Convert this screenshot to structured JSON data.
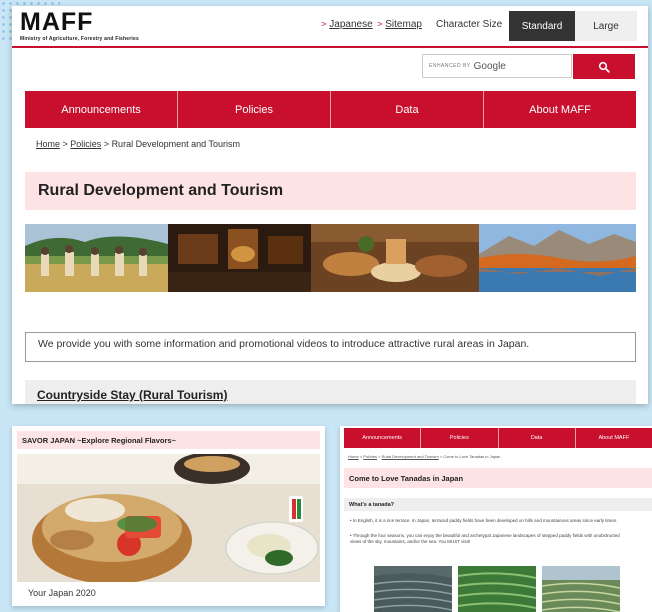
{
  "main": {
    "logo": {
      "text": "MAFF",
      "subtitle": "Ministry of Agriculture, Forestry and Fisheries"
    },
    "header_links": [
      {
        "label": "Japanese"
      },
      {
        "label": "Sitemap"
      }
    ],
    "char_size": {
      "label": "Character Size",
      "standard": "Standard",
      "large": "Large"
    },
    "search": {
      "enhanced_by": "ENHANCED BY",
      "google": "Google",
      "button_icon": "search-icon"
    },
    "nav": [
      "Announcements",
      "Policies",
      "Data",
      "About MAFF"
    ],
    "breadcrumb": {
      "home": "Home",
      "sep1": " > ",
      "policies": "Policies",
      "sep2": " > ",
      "current": "Rural Development and Tourism"
    },
    "page_title": "Rural Development and Tourism",
    "photos": [
      "photo-rice-harvest",
      "photo-old-house-interior",
      "photo-local-food",
      "photo-autumn-mountain-lake"
    ],
    "intro": "We provide you with some information and promotional videos to introduce attractive rural areas in Japan.",
    "section_link": "Countryside Stay (Rural Tourism)"
  },
  "savor": {
    "title": "SAVOR JAPAN ~Explore Regional Flavors~",
    "caption": "Your Japan 2020"
  },
  "tanada": {
    "nav": [
      "Announcements",
      "Policies",
      "Data",
      "About MAFF"
    ],
    "breadcrumb": {
      "home": "Home",
      "sep1": " > ",
      "policies": "Policies",
      "sep2": " > ",
      "rural": "Rural Development and Tourism",
      "sep3": " > ",
      "current": "Come to Love Tanadas in Japan"
    },
    "title": "Come to Love Tanadas in Japan",
    "subtitle": "What's a tanada?",
    "bullets": [
      "In English, it is a rice terrace. In Japan, terraced paddy fields have been developed on hills and mountainous areas since early times.",
      "Through the four seasons, you can enjoy the beautiful and archetypal Japanese landscapes of stepped paddy fields with unobstructed views of the sky, mountains, and/or the sea. You MUST visit!"
    ]
  },
  "colors": {
    "brand_red": "#c8102e",
    "title_bg": "#fde3e3",
    "background": "#c9e6f6"
  }
}
